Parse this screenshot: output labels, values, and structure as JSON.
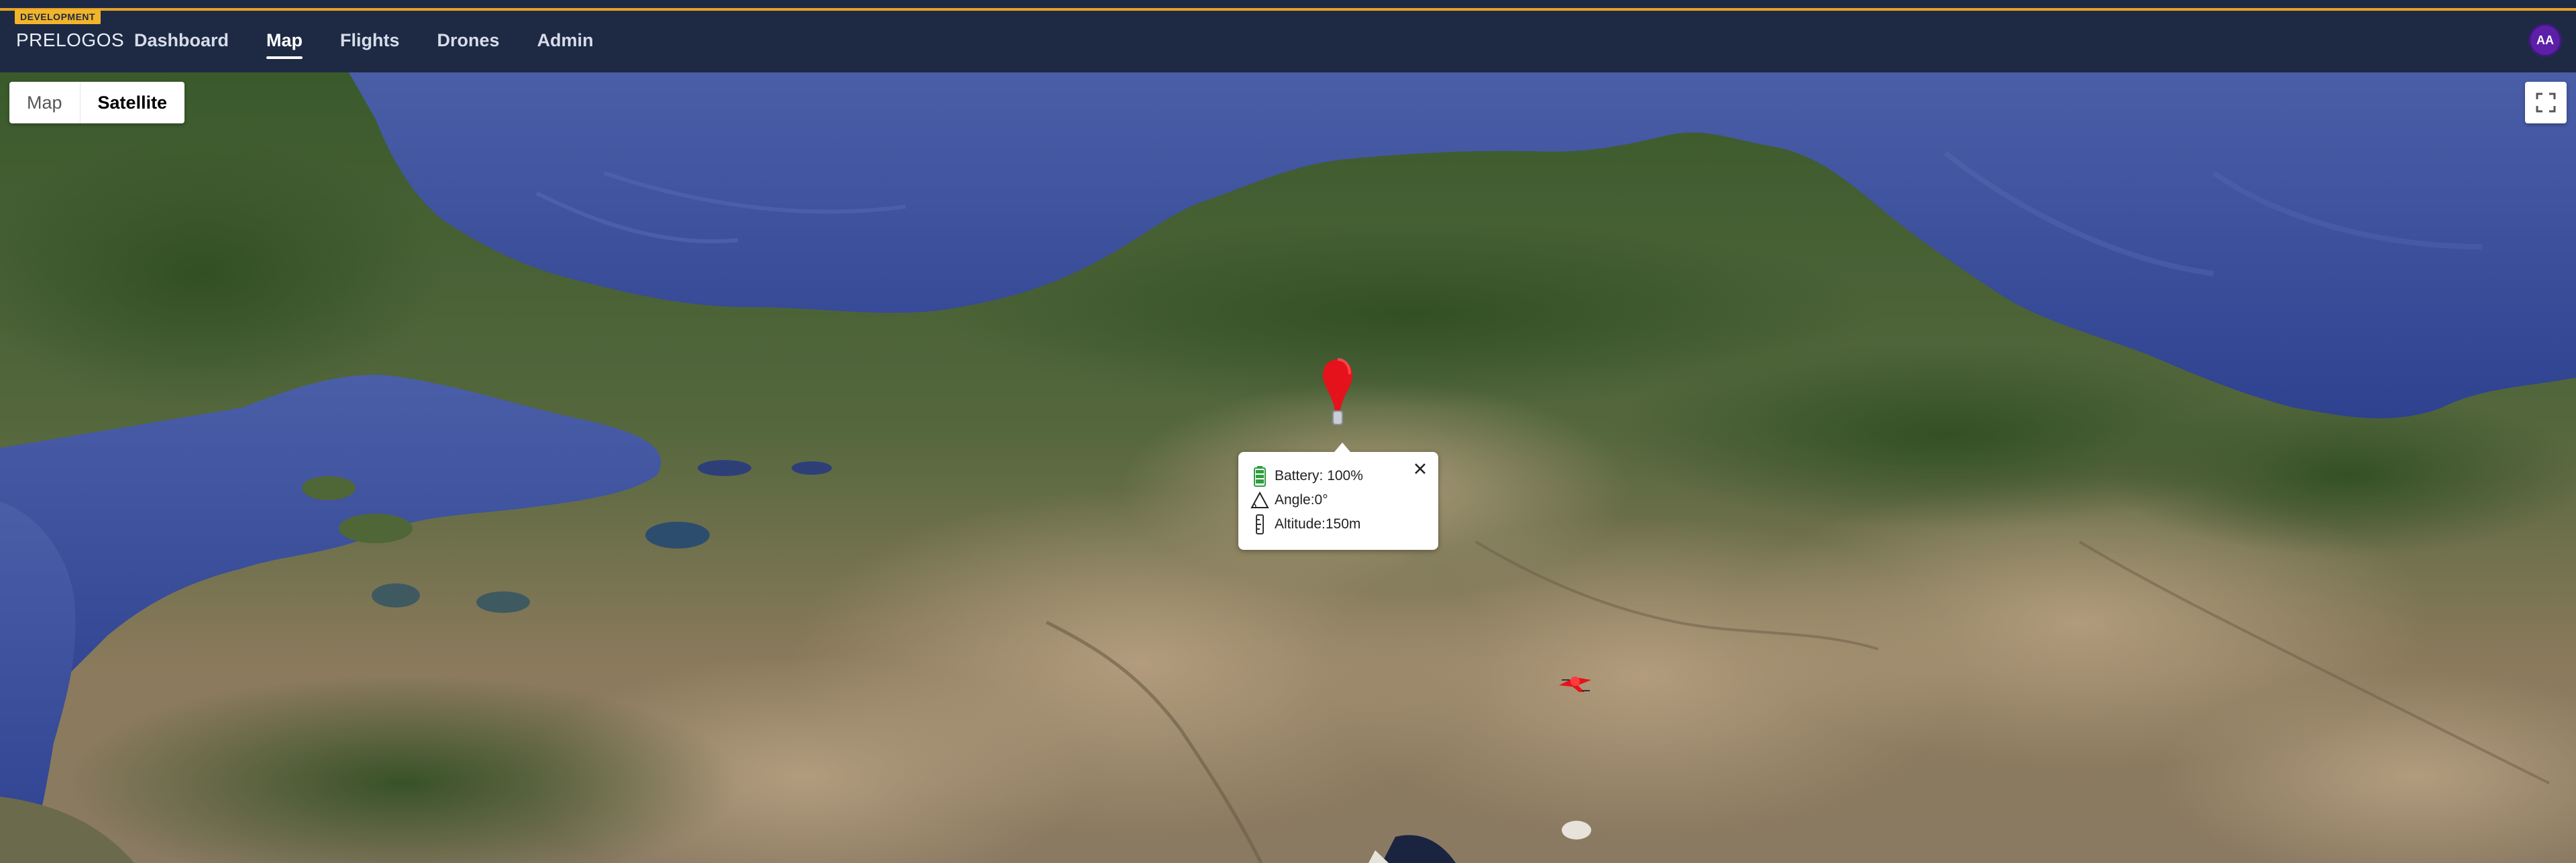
{
  "env_badge": "DEVELOPMENT",
  "brand": "PRELOGOS",
  "nav": {
    "items": [
      {
        "label": "Dashboard",
        "active": false
      },
      {
        "label": "Map",
        "active": true
      },
      {
        "label": "Flights",
        "active": false
      },
      {
        "label": "Drones",
        "active": false
      },
      {
        "label": "Admin",
        "active": false
      }
    ]
  },
  "user": {
    "initials": "AA"
  },
  "map": {
    "type_options": [
      "Map",
      "Satellite"
    ],
    "selected_type": "Satellite",
    "info_window": {
      "battery": "Battery: 100%",
      "angle": "Angle:0°",
      "altitude": "Altitude:150m"
    }
  },
  "colors": {
    "nav_bg": "#1e2a44",
    "accent_bar": "#e6a328",
    "badge": "#f2b52a",
    "avatar": "#5b1fa8",
    "marker": "#e5121b",
    "battery": "#2e9e3f",
    "sea": "#3b4f9c",
    "land_forest": "#3f5a2e",
    "land_dry": "#9a8465"
  },
  "icons": [
    "battery-icon",
    "angle-icon",
    "altitude-icon",
    "close-icon",
    "fullscreen-icon",
    "map-pin-icon",
    "drone-icon"
  ]
}
